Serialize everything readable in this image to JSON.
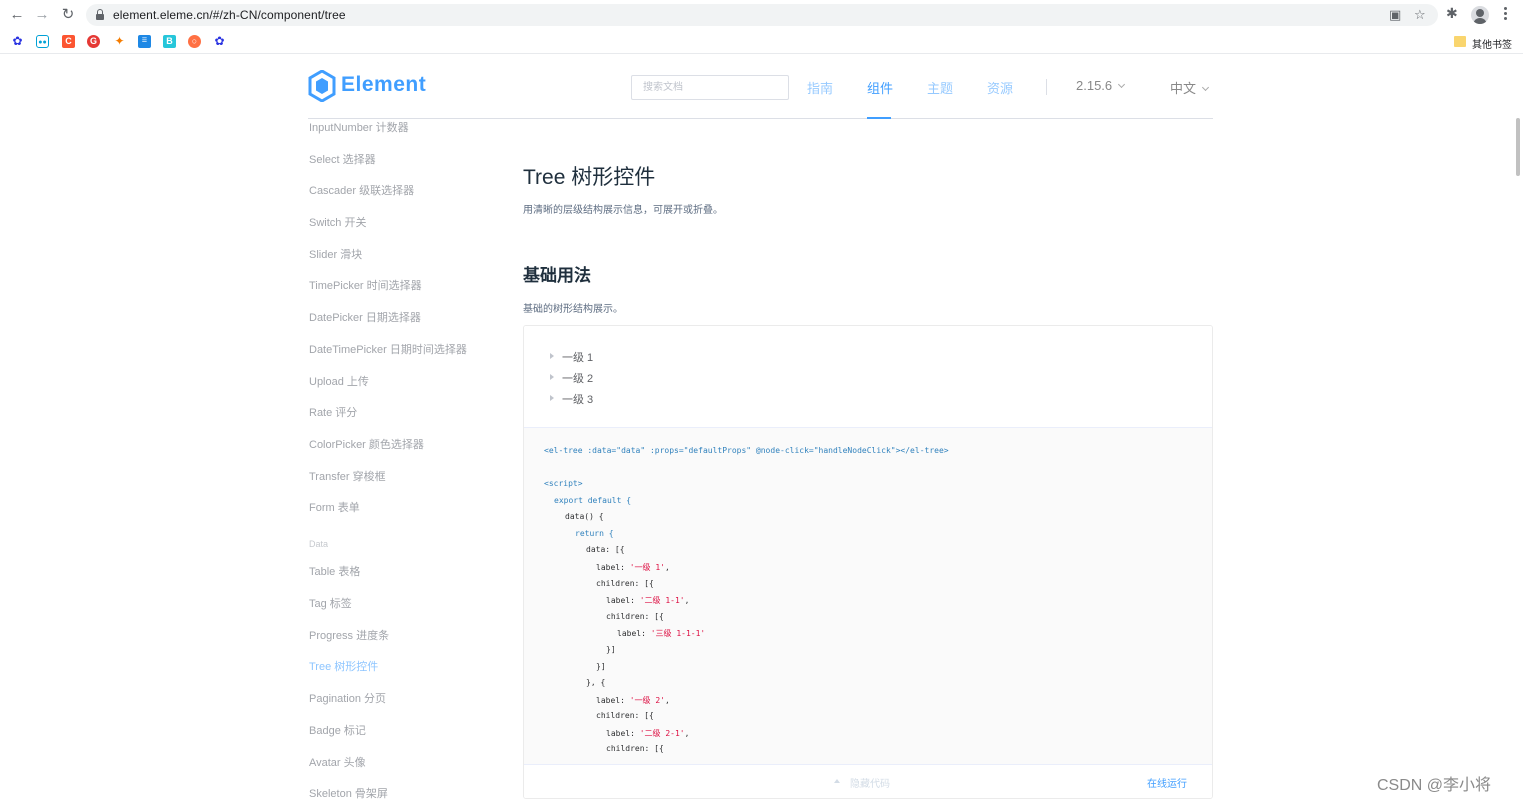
{
  "browser": {
    "url": "element.eleme.cn/#/zh-CN/component/tree",
    "other_bookmarks": "其他书签",
    "bookmarks": [
      {
        "icon": "baidu-paw-icon",
        "color": "#2932e1"
      },
      {
        "icon": "bilibili-tv-icon",
        "color": "#00a1d6"
      },
      {
        "icon": "csdn-c-icon",
        "color": "#fc5531"
      },
      {
        "icon": "google-g-icon",
        "color": "#e53935"
      },
      {
        "icon": "chrome-icon",
        "color": "#fbbc05"
      },
      {
        "icon": "news-icon",
        "color": "#1e88e5"
      },
      {
        "icon": "b-letter-icon",
        "color": "#26c6da"
      },
      {
        "icon": "orange-circle-icon",
        "color": "#ff7043"
      },
      {
        "icon": "baidu-paw-icon-2",
        "color": "#2932e1"
      }
    ]
  },
  "header": {
    "logo_text": "Element",
    "search_placeholder": "搜索文档",
    "nav": [
      "指南",
      "组件",
      "主题",
      "资源"
    ],
    "active_nav_index": 1,
    "version": "2.15.6",
    "language": "中文",
    "accent": "#409eff"
  },
  "sidebar": {
    "items": [
      "InputNumber 计数器",
      "Select 选择器",
      "Cascader 级联选择器",
      "Switch 开关",
      "Slider 滑块",
      "TimePicker 时间选择器",
      "DatePicker 日期选择器",
      "DateTimePicker 日期时间选择器",
      "Upload 上传",
      "Rate 评分",
      "ColorPicker 颜色选择器",
      "Transfer 穿梭框",
      "Form 表单"
    ],
    "group_label": "Data",
    "data_items": [
      "Table 表格",
      "Tag 标签",
      "Progress 进度条",
      "Tree 树形控件",
      "Pagination 分页",
      "Badge 标记",
      "Avatar 头像",
      "Skeleton 骨架屏"
    ],
    "active_item": "Tree 树形控件"
  },
  "main": {
    "title": "Tree 树形控件",
    "description": "用清晰的层级结构展示信息，可展开或折叠。",
    "section_title": "基础用法",
    "section_description": "基础的树形结构展示。",
    "tree_nodes": [
      "一级 1",
      "一级 2",
      "一级 3"
    ],
    "hide_code": "隐藏代码",
    "run_online": "在线运行"
  },
  "code": {
    "template_tag_open": "<el-tree",
    "template_attrs": " :data=\"data\" :props=\"defaultProps\" @node-click=\"handleNodeClick\"",
    "template_tag_close": "></el-tree>",
    "script_open": "<script>",
    "export_default": "export default {",
    "data_fn": "data() {",
    "return_kw": "return {",
    "data_open": "data: [{",
    "label_1": "'一级 1'",
    "label_11": "'二级 1-1'",
    "label_111": "'三级 1-1-1'",
    "label_2": "'一级 2'",
    "label_21": "'二级 2-1'",
    "label_key": "label: ",
    "children_key": "children: [{",
    "close_arr": "}]",
    "close_obj": "}, {"
  },
  "watermark": "CSDN @李小将"
}
